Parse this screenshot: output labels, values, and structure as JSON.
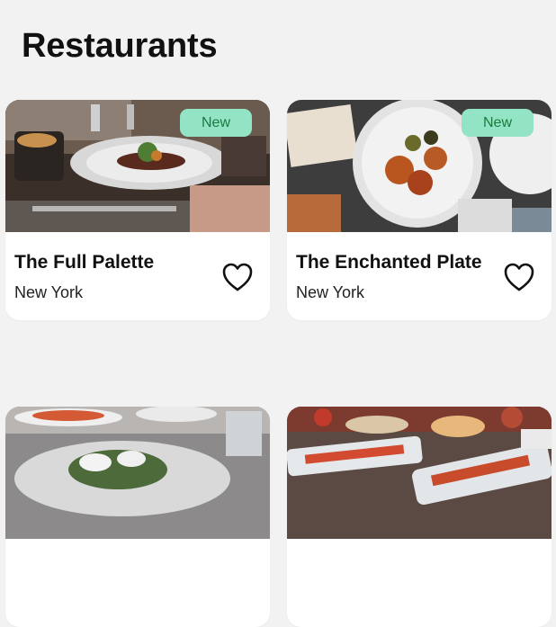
{
  "page": {
    "title": "Restaurants"
  },
  "colors": {
    "background": "#f2f2f2",
    "card": "#ffffff",
    "badge_bg": "#93e4c5",
    "badge_text": "#1a7a3f"
  },
  "restaurants": [
    {
      "name": "The Full Palette",
      "city": "New York",
      "badge": "New",
      "favorite_icon": "heart-outline-icon"
    },
    {
      "name": "The Enchanted Plate",
      "city": "New York",
      "badge": "New",
      "favorite_icon": "heart-outline-icon"
    },
    {
      "name": "",
      "city": "",
      "badge": "",
      "favorite_icon": ""
    },
    {
      "name": "",
      "city": "",
      "badge": "",
      "favorite_icon": ""
    }
  ]
}
